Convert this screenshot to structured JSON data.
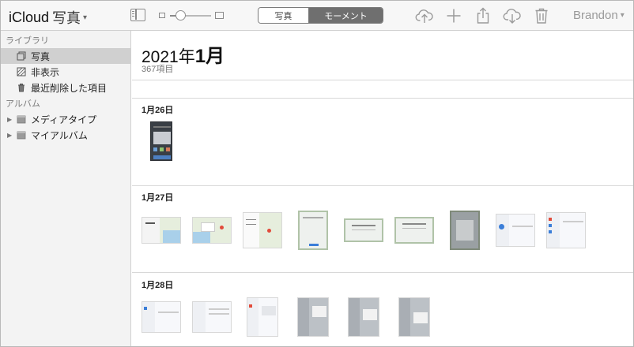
{
  "toolbar": {
    "brand": "iCloud",
    "section": "写真",
    "chevron": "⌄",
    "zoom_level": 0.25,
    "segments": [
      "写真",
      "モーメント"
    ],
    "selected_segment": "モーメント",
    "user": "Brandon",
    "icons": [
      "sidebar-icon",
      "upload-icon",
      "add-icon",
      "share-icon",
      "download-icon",
      "trash-icon"
    ]
  },
  "sidebar": {
    "library_header": "ライブラリ",
    "library_items": [
      {
        "label": "写真",
        "icon": "photos-icon",
        "selected": true
      },
      {
        "label": "非表示",
        "icon": "hidden-icon",
        "selected": false
      },
      {
        "label": "最近削除した項目",
        "icon": "trash-icon",
        "selected": false
      }
    ],
    "albums_header": "アルバム",
    "album_items": [
      {
        "label": "メディアタイプ",
        "icon": "folder-icon"
      },
      {
        "label": "マイアルバム",
        "icon": "folder-icon"
      }
    ]
  },
  "main": {
    "year": "2021年",
    "month": "1月",
    "count": "367項目",
    "days": [
      {
        "label": "1月26日",
        "thumb_count": 1
      },
      {
        "label": "1月27日",
        "thumb_count": 9
      },
      {
        "label": "1月28日",
        "thumb_count": 6
      }
    ]
  },
  "colors": {
    "toolbar_bg": "#f7f7f7",
    "sidebar_bg": "#f3f3f3",
    "selected_row": "#d0d0d0",
    "segment_active": "#6f6f6f"
  }
}
